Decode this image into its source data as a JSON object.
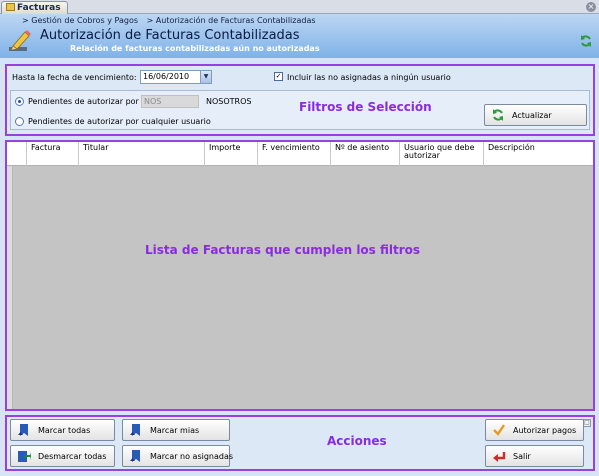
{
  "window": {
    "tab_label": "Facturas"
  },
  "header": {
    "breadcrumb": [
      "> Gestión de Cobros y Pagos",
      "> Autorización de Facturas Contabilizadas"
    ],
    "title": "Autorización de Facturas Contabilizadas",
    "subtitle": "Relación de facturas contabilizadas aún no autorizadas"
  },
  "filters": {
    "due_date_label": "Hasta la fecha de vencimiento:",
    "due_date_value": "16/06/2010",
    "include_unassigned_label": "Incluir las no asignadas a ningún usuario",
    "include_unassigned_checked": true,
    "pending_by_label": "Pendientes de autorizar por",
    "user_code": "NOS",
    "user_name": "NOSOTROS",
    "pending_any_label": "Pendientes de autorizar por cualquier usuario",
    "selected_option": "pending_by",
    "overlay_label": "Filtros de Selección",
    "refresh_label": "Actualizar"
  },
  "table": {
    "columns": [
      "Factura",
      "Titular",
      "Importe",
      "F. vencimiento",
      "Nº de asiento",
      "Usuario que debe autorizar",
      "Descripción"
    ],
    "overlay_label": "Lista de Facturas que cumplen los filtros"
  },
  "actions": {
    "overlay_label": "Acciones",
    "mark_all": "Marcar todas",
    "mark_mine": "Marcar mias",
    "unmark_all": "Desmarcar todas",
    "mark_unassigned": "Marcar no asignadas",
    "authorize": "Autorizar pagos",
    "exit": "Salir"
  },
  "colors": {
    "annotation": "#8a2be2",
    "annotation_border": "#9a3fe0",
    "header_gradient_top": "#bcd6f3",
    "header_gradient_bottom": "#7fb2e8",
    "list_background": "#c4c4c4"
  }
}
